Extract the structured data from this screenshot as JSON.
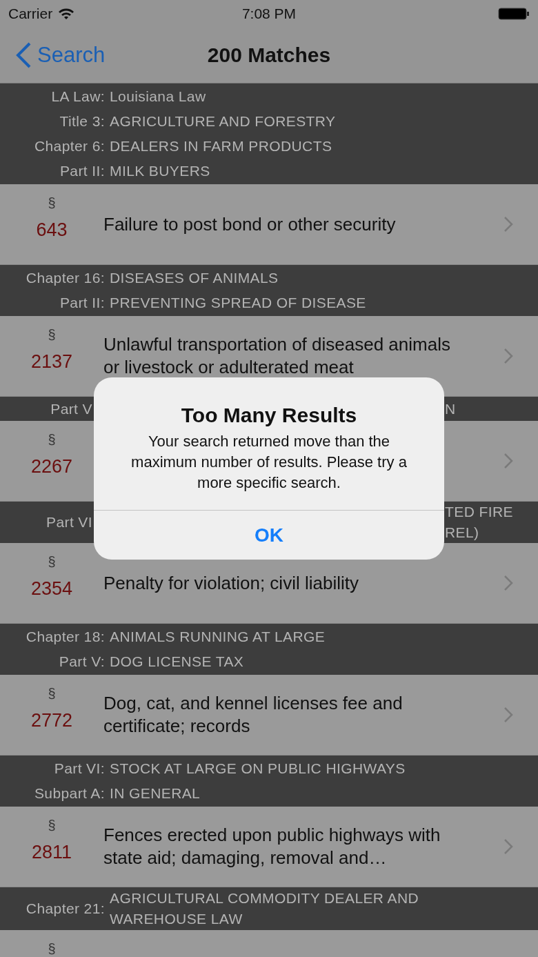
{
  "status_bar": {
    "carrier": "Carrier",
    "time": "7:08 PM"
  },
  "nav": {
    "back": "Search",
    "title": "200 Matches"
  },
  "list": [
    {
      "kind": "header",
      "lines": [
        {
          "label": "LA Law:",
          "value": "Louisiana Law"
        },
        {
          "label": "Title 3:",
          "value": "AGRICULTURE AND FORESTRY"
        },
        {
          "label": "Chapter 6:",
          "value": "DEALERS IN FARM PRODUCTS"
        },
        {
          "label": "Part II:",
          "value": "MILK BUYERS"
        }
      ]
    },
    {
      "kind": "row",
      "symbol": "§",
      "number": "643",
      "title": "Failure to post bond or other security"
    },
    {
      "kind": "header",
      "lines": [
        {
          "label": "Chapter 16:",
          "value": "DISEASES OF ANIMALS"
        },
        {
          "label": "Part II:",
          "value": "PREVENTING SPREAD OF DISEASE"
        }
      ]
    },
    {
      "kind": "row",
      "symbol": "§",
      "number": "2137",
      "title": "Unlawful transportation of diseased animals or livestock or adulterated meat"
    },
    {
      "kind": "split",
      "label": "Part V",
      "tail": [
        "N"
      ]
    },
    {
      "kind": "row",
      "symbol": "§",
      "number": "2267"
    },
    {
      "kind": "split",
      "label": "Part VI",
      "tail": [
        "TED FIRE",
        "REL)"
      ]
    },
    {
      "kind": "row",
      "symbol": "§",
      "number": "2354",
      "title": "Penalty for violation; civil liability"
    },
    {
      "kind": "header",
      "lines": [
        {
          "label": "Chapter 18:",
          "value": "ANIMALS RUNNING AT LARGE"
        },
        {
          "label": "Part V:",
          "value": "DOG LICENSE TAX"
        }
      ]
    },
    {
      "kind": "row",
      "symbol": "§",
      "number": "2772",
      "title": "Dog, cat, and kennel licenses fee and certificate; records"
    },
    {
      "kind": "header",
      "lines": [
        {
          "label": "Part VI:",
          "value": "STOCK AT LARGE ON PUBLIC HIGHWAYS"
        },
        {
          "label": "Subpart A:",
          "value": "IN GENERAL"
        }
      ]
    },
    {
      "kind": "row",
      "symbol": "§",
      "number": "2811",
      "title": "Fences erected upon public highways with state aid; damaging, removal and…"
    },
    {
      "kind": "header",
      "lines": [
        {
          "label": "Chapter 21:",
          "value": "AGRICULTURAL COMMODITY DEALER AND WAREHOUSE LAW"
        }
      ]
    },
    {
      "kind": "row",
      "symbol": "§"
    }
  ],
  "alert": {
    "title": "Too Many Results",
    "message": "Your search returned move than the maximum number of results. Please try a more specific search.",
    "button": "OK"
  }
}
